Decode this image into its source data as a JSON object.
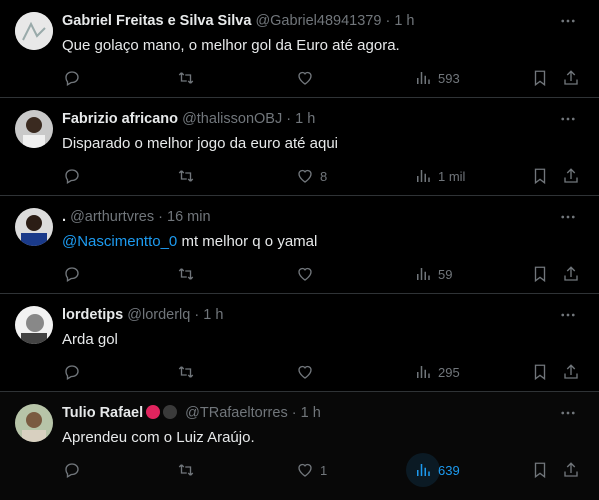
{
  "tweets": [
    {
      "name": "Gabriel Freitas e Silva Silva",
      "handle": "@Gabriel48941379",
      "time": "1 h",
      "text": "Que golaço mano, o melhor gol da Euro até agora.",
      "replies": "",
      "retweets": "",
      "likes": "",
      "views": "593"
    },
    {
      "name": "Fabrizio africano",
      "handle": "@thalissonOBJ",
      "time": "1 h",
      "text": "Disparado o melhor jogo da euro até aqui",
      "replies": "",
      "retweets": "",
      "likes": "8",
      "views": "1 mil"
    },
    {
      "name": ".",
      "handle": "@arthurtvres",
      "time": "16 min",
      "mention": "@Nascimentto_0",
      "text": "mt melhor q o yamal",
      "replies": "",
      "retweets": "",
      "likes": "",
      "views": "59"
    },
    {
      "name": "lordetips",
      "handle": "@lorderlq",
      "time": "1 h",
      "text": "Arda gol",
      "replies": "",
      "retweets": "",
      "likes": "",
      "views": "295"
    },
    {
      "name": "Tulio Rafael",
      "handle": "@TRafaeltorres",
      "time": "1 h",
      "text": "Aprendeu com o Luiz Araújo.",
      "replies": "",
      "retweets": "",
      "likes": "1",
      "views": "639"
    }
  ],
  "separator": "·",
  "colors": {
    "background": "#000000",
    "text": "#e7e9ea",
    "secondary": "#71767b",
    "accent": "#1d9bf0",
    "border": "#2f3336"
  },
  "icons": [
    "more-icon",
    "reply-icon",
    "retweet-icon",
    "like-icon",
    "views-icon",
    "bookmark-icon",
    "share-icon"
  ]
}
